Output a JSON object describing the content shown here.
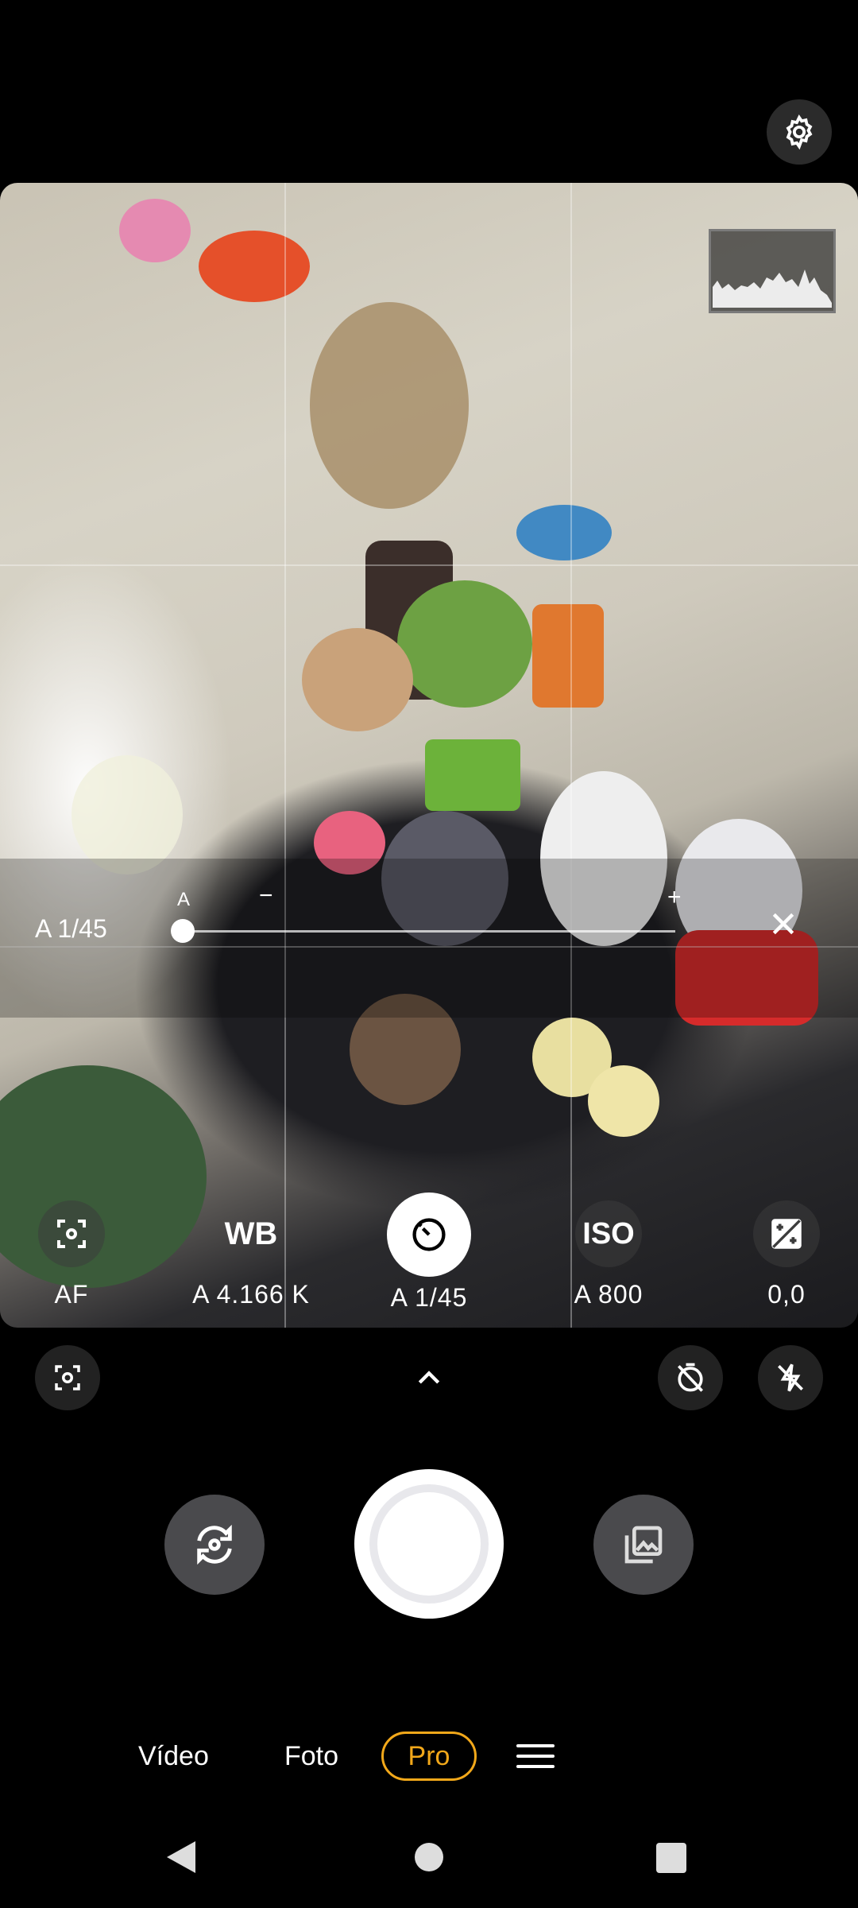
{
  "top": {
    "settings_icon": "gear-icon"
  },
  "viewfinder": {
    "histogram_icon": "histogram"
  },
  "shutter_slider": {
    "current_value": "A 1/45",
    "auto_marker": "A",
    "minus": "−",
    "plus": "+",
    "close_icon": "close-icon"
  },
  "pro_controls": [
    {
      "name": "af",
      "icon": "focus-icon",
      "text": "",
      "label": "AF"
    },
    {
      "name": "wb",
      "icon": "",
      "text": "WB",
      "label": "A 4.166 K"
    },
    {
      "name": "shutter-speed",
      "icon": "shutter-timer-icon",
      "text": "",
      "label": "A 1/45"
    },
    {
      "name": "iso",
      "icon": "",
      "text": "ISO",
      "label": "A 800"
    },
    {
      "name": "exposure",
      "icon": "exposure-icon",
      "text": "",
      "label": "0,0"
    }
  ],
  "toolbar": {
    "lens_icon": "lens-focus-icon",
    "expand_icon": "chevron-up-icon",
    "timer_icon": "timer-off-icon",
    "flash_icon": "flash-off-icon"
  },
  "bottom": {
    "switch_camera_icon": "switch-camera-icon",
    "gallery_icon": "gallery-icon"
  },
  "modes": {
    "video": "Vídeo",
    "photo": "Foto",
    "pro": "Pro",
    "menu_icon": "menu-icon",
    "active": "Pro",
    "active_color": "#f2a81a"
  },
  "nav": {
    "back": "back-icon",
    "home": "home-icon",
    "recent": "recents-icon"
  }
}
